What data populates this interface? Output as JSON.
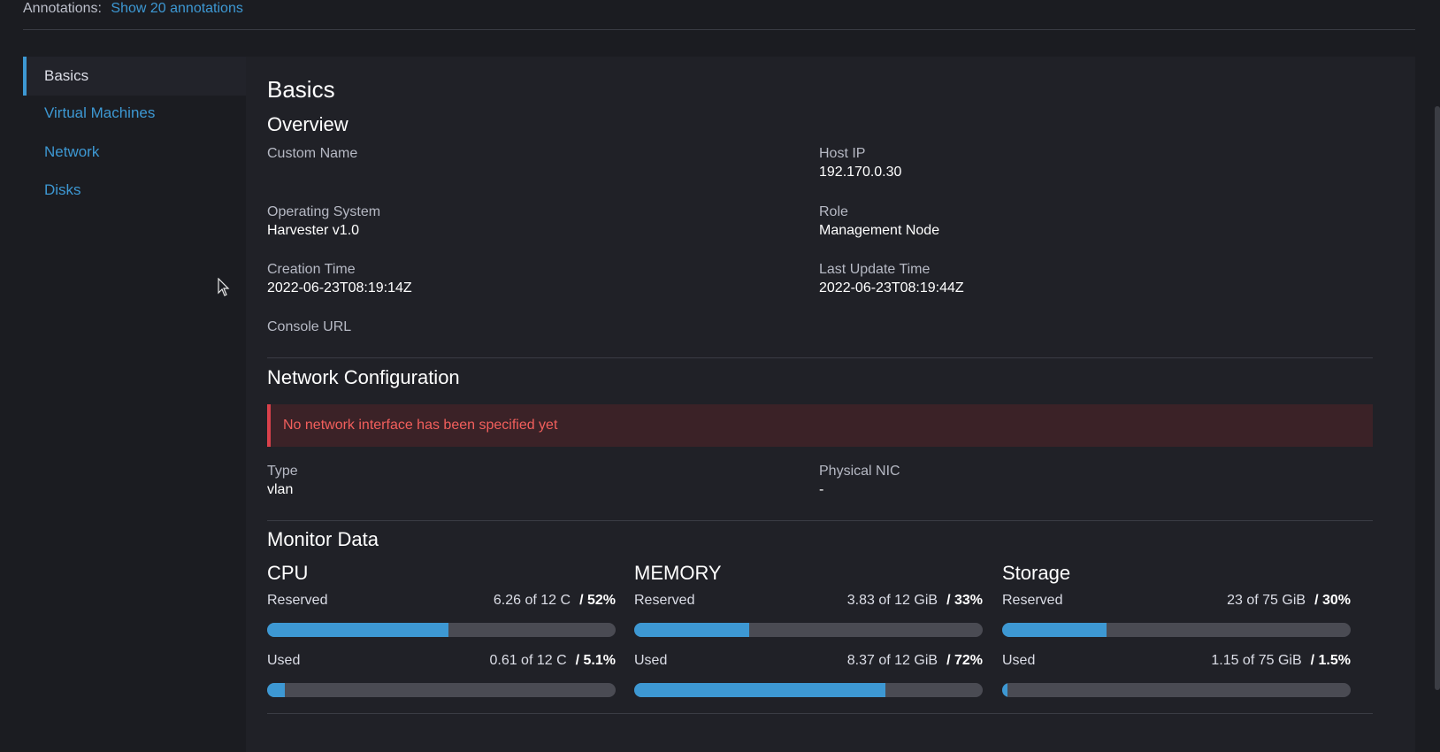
{
  "annotations": {
    "label": "Annotations:",
    "link": "Show 20 annotations"
  },
  "sidebar": {
    "items": [
      {
        "label": "Basics",
        "active": true
      },
      {
        "label": "Virtual Machines"
      },
      {
        "label": "Network"
      },
      {
        "label": "Disks"
      }
    ]
  },
  "basics": {
    "title": "Basics",
    "overview_title": "Overview",
    "custom_name": {
      "label": "Custom Name",
      "value": ""
    },
    "host_ip": {
      "label": "Host IP",
      "value": "192.170.0.30"
    },
    "os": {
      "label": "Operating System",
      "value": "Harvester v1.0"
    },
    "role": {
      "label": "Role",
      "value": "Management Node"
    },
    "creation_time": {
      "label": "Creation Time",
      "value": "2022-06-23T08:19:14Z"
    },
    "last_update_time": {
      "label": "Last Update Time",
      "value": "2022-06-23T08:19:44Z"
    },
    "console_url": {
      "label": "Console URL",
      "value": ""
    }
  },
  "network": {
    "title": "Network Configuration",
    "banner": "No network interface has been specified yet",
    "type": {
      "label": "Type",
      "value": "vlan"
    },
    "nic": {
      "label": "Physical NIC",
      "value": "-"
    }
  },
  "monitor": {
    "title": "Monitor Data",
    "gauges": [
      {
        "title": "CPU",
        "reserved": {
          "label": "Reserved",
          "amount": "6.26 of 12 C",
          "percent": "/ 52%",
          "fraction": 0.52
        },
        "used": {
          "label": "Used",
          "amount": "0.61 of 12 C",
          "percent": "/ 5.1%",
          "fraction": 0.051
        }
      },
      {
        "title": "MEMORY",
        "reserved": {
          "label": "Reserved",
          "amount": "3.83 of 12 GiB",
          "percent": "/ 33%",
          "fraction": 0.33
        },
        "used": {
          "label": "Used",
          "amount": "8.37 of 12 GiB",
          "percent": "/ 72%",
          "fraction": 0.72
        }
      },
      {
        "title": "Storage",
        "reserved": {
          "label": "Reserved",
          "amount": "23 of 75 GiB",
          "percent": "/ 30%",
          "fraction": 0.3
        },
        "used": {
          "label": "Used",
          "amount": "1.15 of 75 GiB",
          "percent": "/ 1.5%",
          "fraction": 0.015
        }
      }
    ]
  },
  "colors": {
    "accent": "#3d98d3",
    "error": "#d9414b",
    "bar_track": "#4a4b53"
  }
}
